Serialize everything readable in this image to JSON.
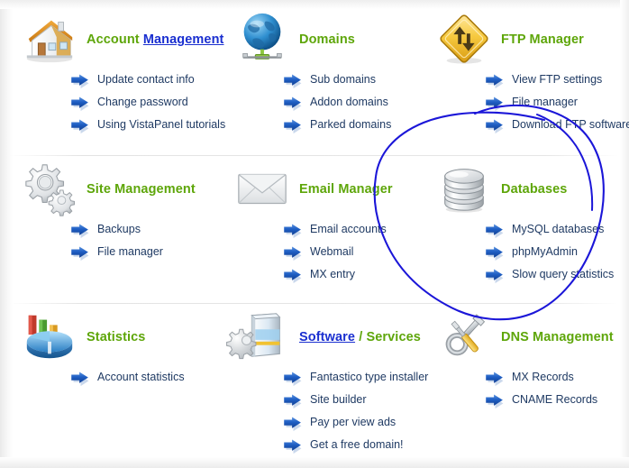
{
  "page": {
    "background": "#ffffff",
    "heading_color": "#5ea60a",
    "link_color": "#1a2fd0",
    "item_text_color": "#1f3a63",
    "annotation_color": "#1b16d8"
  },
  "annotation": {
    "name": "hand-drawn-circle",
    "shape": "ellipse",
    "target": "Databases panel",
    "color": "#1b16d8"
  },
  "panels": [
    {
      "id": "account-management",
      "icon": "house-icon",
      "title_parts": [
        {
          "text": "Account",
          "style": "green"
        },
        {
          "text": "Management",
          "style": "link"
        }
      ],
      "items": [
        {
          "label": "Update contact info"
        },
        {
          "label": "Change password"
        },
        {
          "label": "Using VistaPanel tutorials"
        }
      ]
    },
    {
      "id": "domains",
      "icon": "globe-icon",
      "title_parts": [
        {
          "text": "Domains",
          "style": "green"
        }
      ],
      "items": [
        {
          "label": "Sub domains"
        },
        {
          "label": "Addon domains"
        },
        {
          "label": "Parked domains"
        }
      ]
    },
    {
      "id": "ftp-manager",
      "icon": "ftp-diamond-icon",
      "title_parts": [
        {
          "text": "FTP Manager",
          "style": "green"
        }
      ],
      "items": [
        {
          "label": "View FTP settings"
        },
        {
          "label": "File manager"
        },
        {
          "label": "Download FTP software"
        }
      ]
    },
    {
      "id": "site-management",
      "icon": "gears-icon",
      "title_parts": [
        {
          "text": "Site Management",
          "style": "green"
        }
      ],
      "items": [
        {
          "label": "Backups"
        },
        {
          "label": "File manager"
        }
      ]
    },
    {
      "id": "email-manager",
      "icon": "envelope-icon",
      "title_parts": [
        {
          "text": "Email Manager",
          "style": "green"
        }
      ],
      "items": [
        {
          "label": "Email accounts"
        },
        {
          "label": "Webmail"
        },
        {
          "label": "MX entry"
        }
      ]
    },
    {
      "id": "databases",
      "icon": "database-cylinder-icon",
      "title_parts": [
        {
          "text": "Databases",
          "style": "green"
        }
      ],
      "items": [
        {
          "label": "MySQL databases"
        },
        {
          "label": "phpMyAdmin"
        },
        {
          "label": "Slow query statistics"
        }
      ]
    },
    {
      "id": "statistics",
      "icon": "pie-chart-icon",
      "title_parts": [
        {
          "text": "Statistics",
          "style": "green"
        }
      ],
      "items": [
        {
          "label": "Account statistics"
        }
      ]
    },
    {
      "id": "software-services",
      "icon": "software-box-gear-icon",
      "title_parts": [
        {
          "text": "Software",
          "style": "link"
        },
        {
          "text": "/",
          "style": "sep"
        },
        {
          "text": "Services",
          "style": "green"
        }
      ],
      "items": [
        {
          "label": "Fantastico type installer"
        },
        {
          "label": "Site builder"
        },
        {
          "label": "Pay per view ads"
        },
        {
          "label": "Get a free domain!"
        }
      ]
    },
    {
      "id": "dns-management",
      "icon": "wrench-screwdriver-icon",
      "title_parts": [
        {
          "text": "DNS Management",
          "style": "green"
        }
      ],
      "items": [
        {
          "label": "MX Records"
        },
        {
          "label": "CNAME Records"
        }
      ]
    }
  ]
}
